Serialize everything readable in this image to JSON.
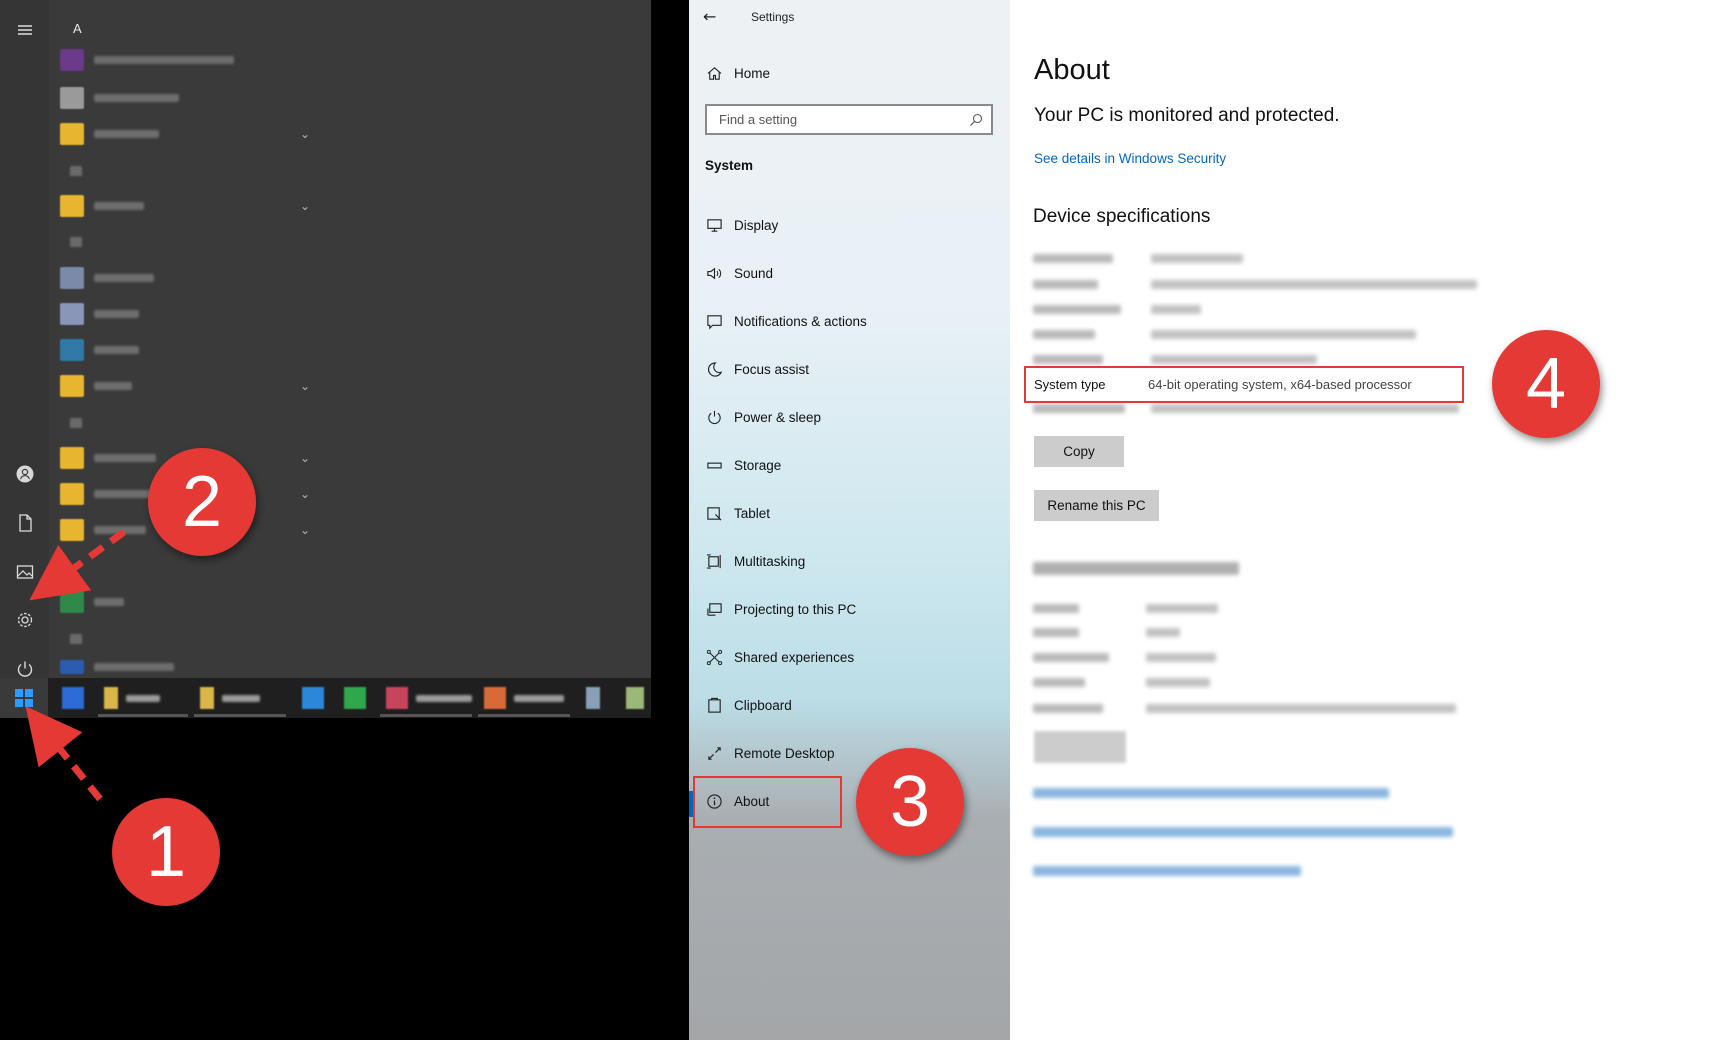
{
  "start_menu": {
    "letter_header": "A",
    "rail": {
      "hamburger_icon": "hamburger-icon",
      "user_icon": "user-icon",
      "documents_icon": "document-icon",
      "pictures_icon": "pictures-icon",
      "settings_icon": "gear-icon",
      "power_icon": "power-icon"
    }
  },
  "taskbar": {
    "start_icon": "windows-logo-icon"
  },
  "settings_nav": {
    "window_title": "Settings",
    "home_label": "Home",
    "search_placeholder": "Find a setting",
    "section_heading": "System",
    "items": [
      {
        "label": "Display",
        "icon": "display-icon"
      },
      {
        "label": "Sound",
        "icon": "sound-icon"
      },
      {
        "label": "Notifications & actions",
        "icon": "notifications-icon"
      },
      {
        "label": "Focus assist",
        "icon": "moon-icon"
      },
      {
        "label": "Power & sleep",
        "icon": "power-icon"
      },
      {
        "label": "Storage",
        "icon": "storage-icon"
      },
      {
        "label": "Tablet",
        "icon": "tablet-icon"
      },
      {
        "label": "Multitasking",
        "icon": "multitasking-icon"
      },
      {
        "label": "Projecting to this PC",
        "icon": "projecting-icon"
      },
      {
        "label": "Shared experiences",
        "icon": "shared-icon"
      },
      {
        "label": "Clipboard",
        "icon": "clipboard-icon"
      },
      {
        "label": "Remote Desktop",
        "icon": "remote-desktop-icon"
      },
      {
        "label": "About",
        "icon": "info-icon"
      }
    ],
    "selected": "About"
  },
  "content": {
    "title": "About",
    "protection_status": "Your PC is monitored and protected.",
    "security_link": "See details in Windows Security",
    "device_specs_heading": "Device specifications",
    "system_type_label": "System type",
    "system_type_value": "64-bit operating system, x64-based processor",
    "copy_button": "Copy",
    "rename_button": "Rename this PC"
  },
  "annotations": {
    "step1": "1",
    "step2": "2",
    "step3": "3",
    "step4": "4",
    "color": "#e53935"
  },
  "colors": {
    "accent": "#0067c0",
    "start_bg": "#3a3a3a",
    "taskbar_bg": "#1f1f1f",
    "annotation_red": "#e53935"
  }
}
